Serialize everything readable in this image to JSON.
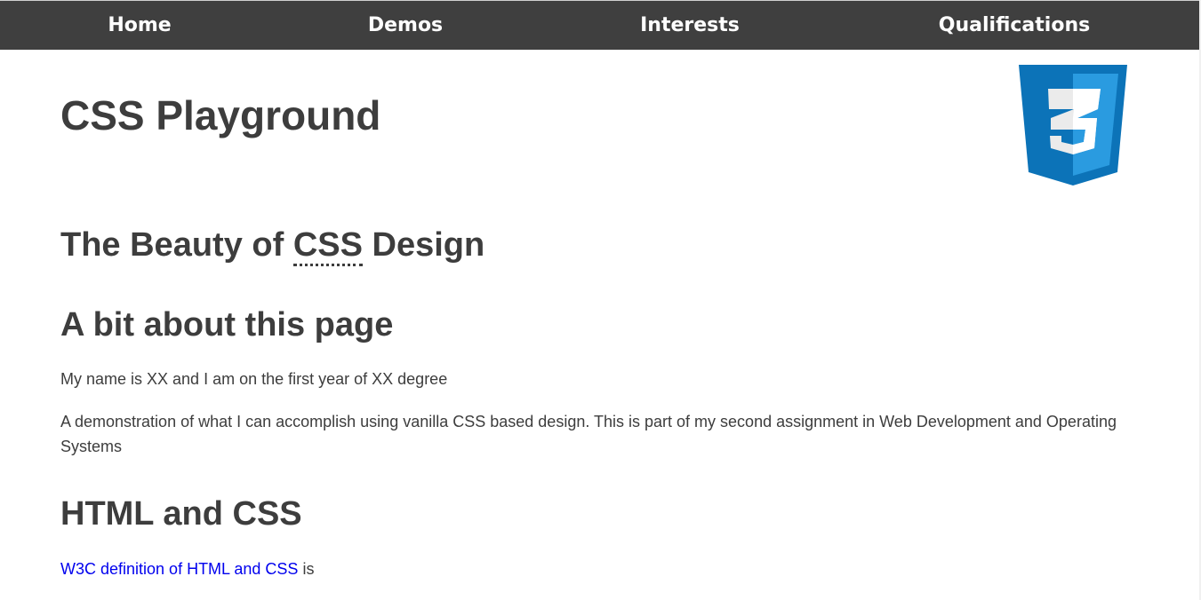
{
  "nav": {
    "items": [
      {
        "label": "Home"
      },
      {
        "label": "Demos"
      },
      {
        "label": "Interests"
      },
      {
        "label": "Qualifications"
      }
    ]
  },
  "header": {
    "title": "CSS Playground",
    "logo_icon": "css3-logo-icon"
  },
  "main": {
    "heading1_prefix": "The Beauty of ",
    "heading1_abbr": "CSS",
    "heading1_suffix": " Design",
    "about": {
      "heading": "A bit about this page",
      "paragraph1": "My name is XX and I am on the first year of XX degree",
      "paragraph2": "A demonstration of what I can accomplish using vanilla CSS based design. This is part of my second assignment in Web Development and Operating Systems"
    },
    "html_css": {
      "heading": "HTML and CSS",
      "link_text": "W3C definition of HTML and CSS",
      "trailing_text": " is"
    }
  },
  "colors": {
    "nav_background": "#3f3f3f",
    "text": "#3d3d3d",
    "link": "#0000ee",
    "logo_dark": "#0c73b8",
    "logo_light": "#2a9be0"
  }
}
